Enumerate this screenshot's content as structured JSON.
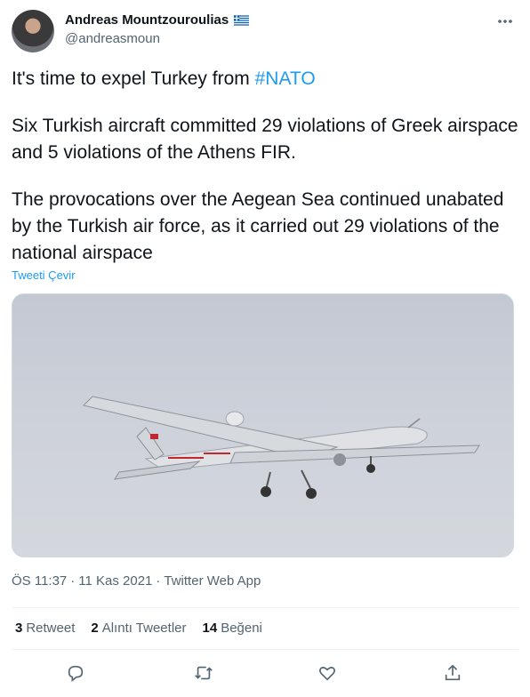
{
  "author": {
    "display_name": "Andreas Mountzouroulias",
    "handle": "@andreasmoun",
    "flag_icon": "greece-flag-icon"
  },
  "tweet": {
    "line1_prefix": "It's time to expel Turkey from ",
    "hashtag": "#NATO",
    "paragraph2": "Six Turkish aircraft committed 29 violations of Greek airspace and 5 violations of the Athens FIR.",
    "paragraph3": "The provocations over the Aegean Sea continued unabated by the Turkish air force, as it carried out 29 violations of the national airspace",
    "translate_label": "Tweeti Çevir"
  },
  "meta": {
    "time": "ÖS 11:37",
    "separator": "·",
    "date": "11 Kas 2021",
    "source": "Twitter Web App"
  },
  "stats": {
    "retweets_count": "3",
    "retweets_label": "Retweet",
    "quotes_count": "2",
    "quotes_label": "Alıntı Tweetler",
    "likes_count": "14",
    "likes_label": "Beğeni"
  },
  "colors": {
    "accent": "#1d9bf0",
    "text": "#0f1419",
    "secondary": "#536471"
  }
}
